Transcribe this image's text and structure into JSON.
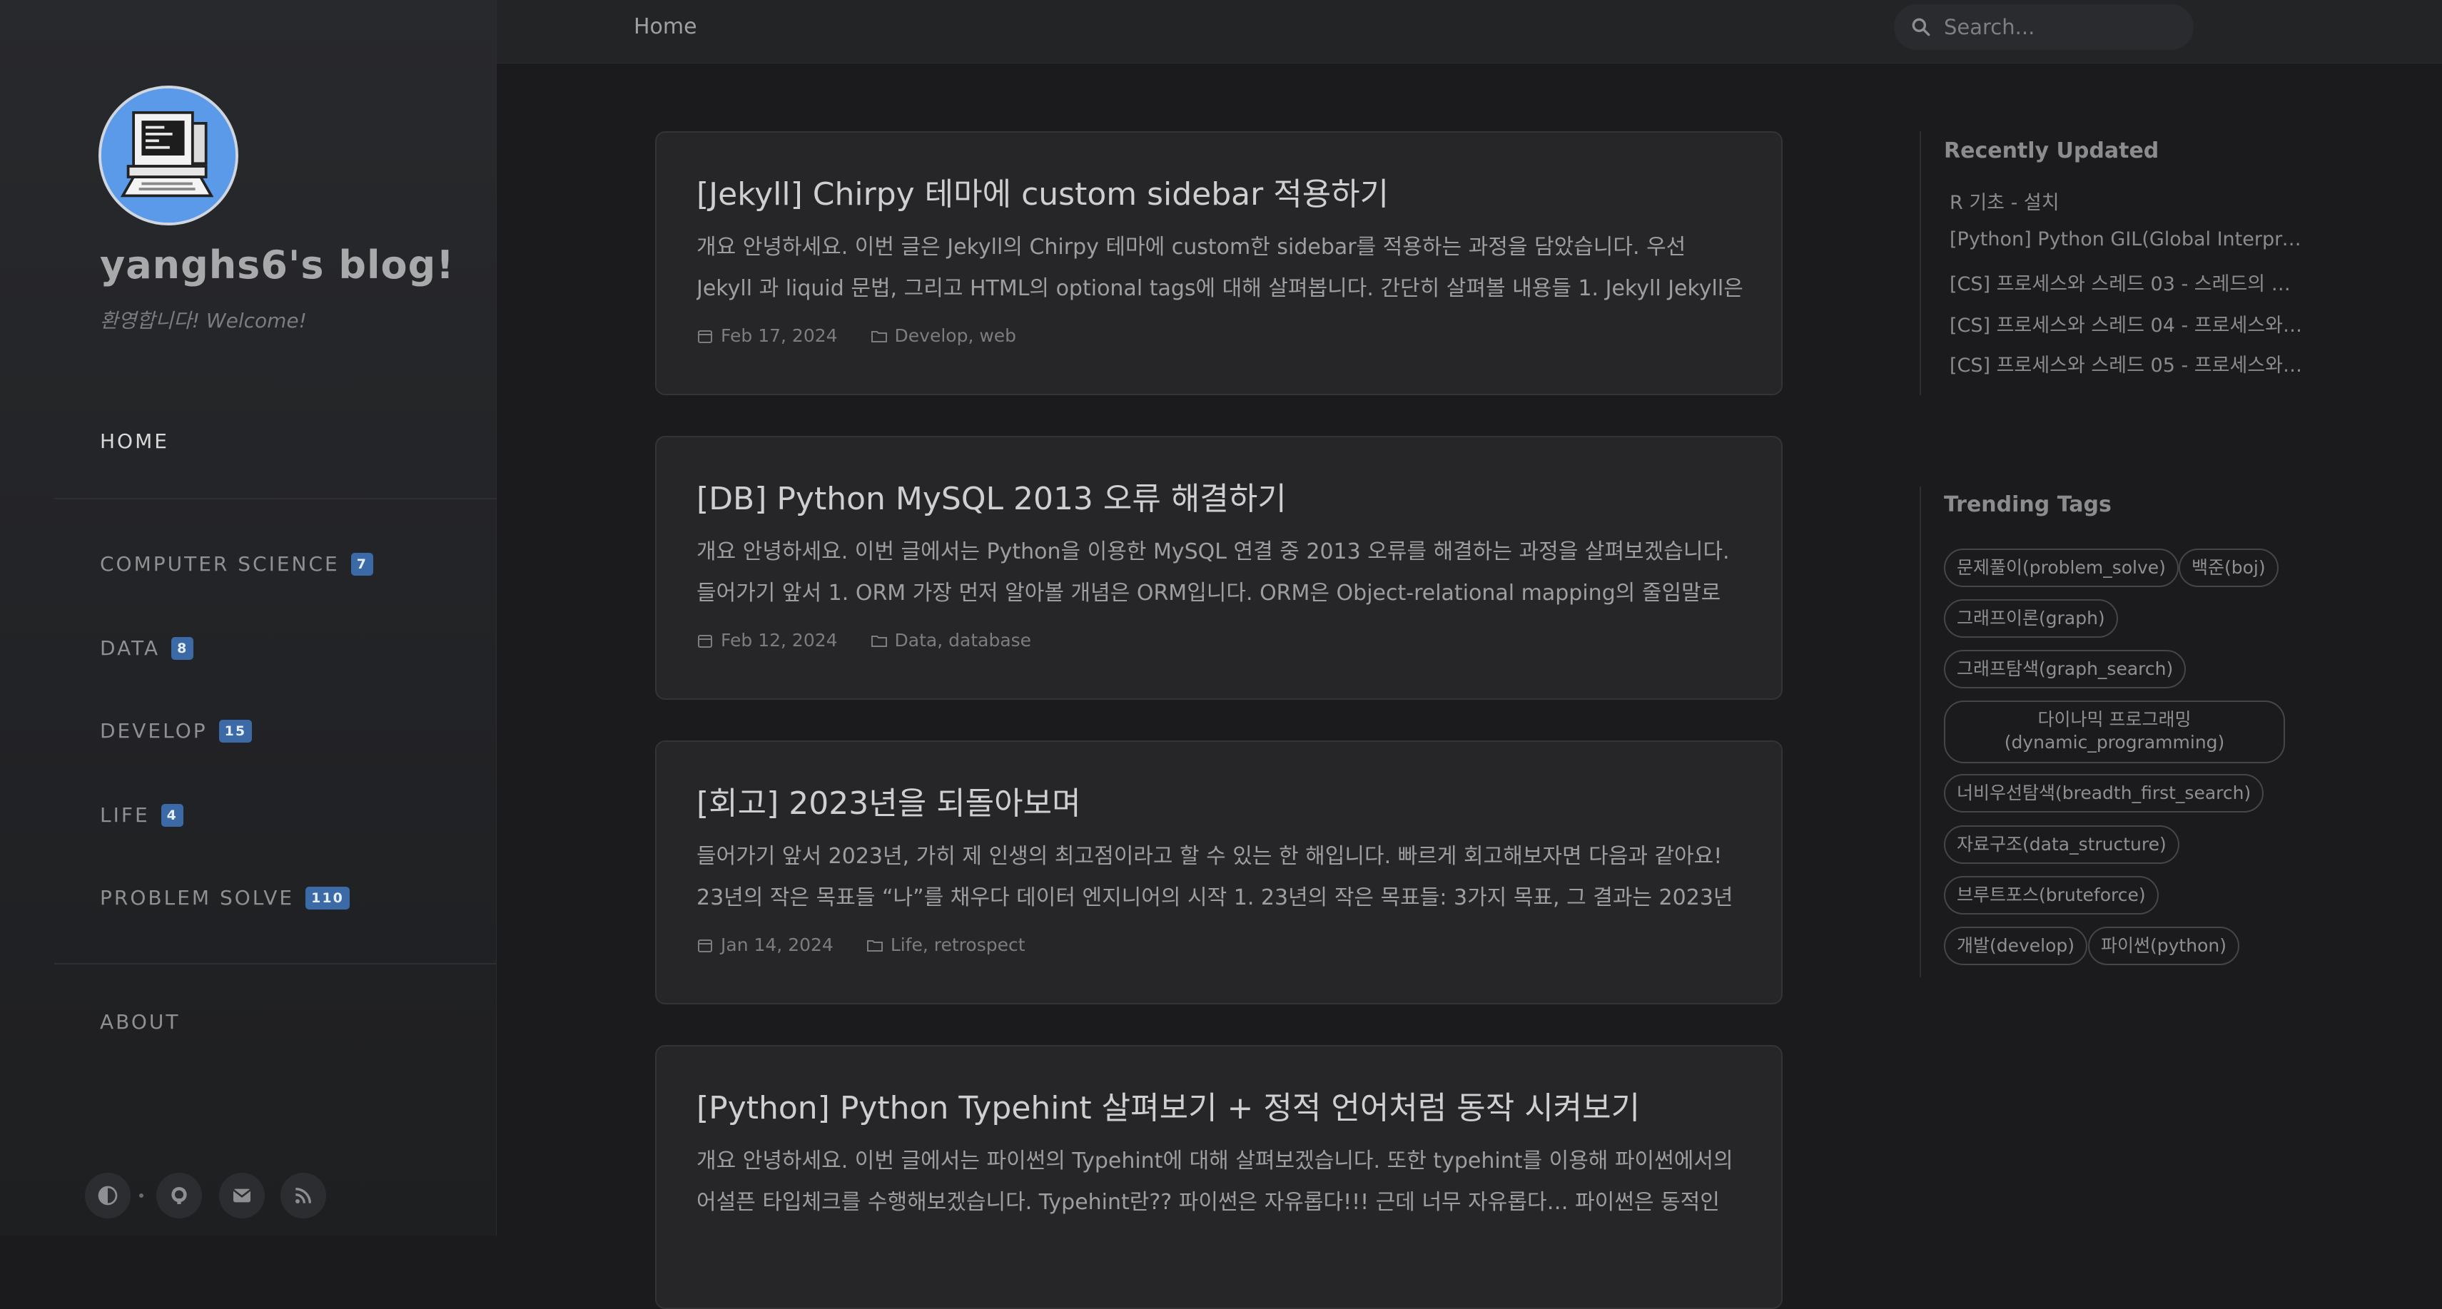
{
  "site": {
    "title": "yanghs6's blog!",
    "subtitle": "환영합니다! Welcome!"
  },
  "nav": {
    "home": "HOME",
    "categories": [
      {
        "label": "COMPUTER SCIENCE",
        "count": "7"
      },
      {
        "label": "DATA",
        "count": "8"
      },
      {
        "label": "DEVELOP",
        "count": "15"
      },
      {
        "label": "LIFE",
        "count": "4"
      },
      {
        "label": "PROBLEM SOLVE",
        "count": "110"
      }
    ],
    "about": "ABOUT"
  },
  "social_icons": [
    "theme-toggle-icon",
    "github-icon",
    "email-icon",
    "rss-icon"
  ],
  "topbar": {
    "breadcrumb": "Home",
    "search_placeholder": "Search..."
  },
  "posts": [
    {
      "title": "[Jekyll] Chirpy 테마에 custom sidebar 적용하기",
      "excerpt": "개요 안녕하세요. 이번 글은 Jekyll의 Chirpy 테마에 custom한 sidebar를 적용하는 과정을 담았습니다. 우선 Jekyll 과 liquid 문법, 그리고 HTML의 optional tags에 대해 살펴봅니다. 간단히 살펴볼 내용들 1. Jekyll Jekyll은 Ruby …",
      "date": "Feb 17, 2024",
      "categories": "Develop, web"
    },
    {
      "title": "[DB] Python MySQL 2013 오류 해결하기",
      "excerpt": "개요 안녕하세요. 이번 글에서는 Python을 이용한 MySQL 연결 중 2013 오류를 해결하는 과정을 살펴보겠습니다. 들어가기 앞서 1. ORM 가장 먼저 알아볼 개념은 ORM입니다. ORM은 Object-relational mapping의 줄임말로 관계…",
      "date": "Feb 12, 2024",
      "categories": "Data, database"
    },
    {
      "title": "[회고] 2023년을 되돌아보며",
      "excerpt": "들어가기 앞서 2023년, 가히 제 인생의 최고점이라고 할 수 있는 한 해입니다. 빠르게 회고해보자면 다음과 같아요! 23년의 작은 목표들 “나”를 채우다 데이터 엔지니어의 시작 1. 23년의 작은 목표들: 3가지 목표, 그 결과는 2023년 회…",
      "date": "Jan 14, 2024",
      "categories": "Life, retrospect"
    },
    {
      "title": "[Python] Python Typehint 살펴보기 + 정적 언어처럼 동작 시켜보기",
      "excerpt": "개요 안녕하세요. 이번 글에서는 파이썬의 Typehint에 대해 살펴보겠습니다. 또한 typehint를 이용해 파이썬에서의 어설픈 타입체크를 수행해보겠습니다. Typehint란?? 파이썬은 자유롭다!!! 근데 너무 자유롭다… 파이썬은 동적인 …",
      "date": "",
      "categories": ""
    }
  ],
  "recently_updated": {
    "heading": "Recently Updated",
    "items": [
      "R 기초 - 설치",
      "[Python] Python GIL(Global Interpreter…",
      "[CS] 프로세스와 스레드 03 - 스레드의 개념…",
      "[CS] 프로세스와 스레드 04 - 프로세스와 상…",
      "[CS] 프로세스와 스레드 05 - 프로세스와 여…"
    ]
  },
  "trending_tags": {
    "heading": "Trending Tags",
    "tags": [
      "문제풀이(problem_solve)",
      "백준(boj)",
      "그래프이론(graph)",
      "그래프탐색(graph_search)",
      "다이나믹 프로그래밍(dynamic_programming)",
      "너비우선탐색(breadth_first_search)",
      "자료구조(data_structure)",
      "브루트포스(bruteforce)",
      "개발(develop)",
      "파이썬(python)"
    ]
  },
  "colors": {
    "accent_badge": "#3b6aa6",
    "avatar_bg": "#5a9ae8",
    "background": "#1b1b1e"
  }
}
